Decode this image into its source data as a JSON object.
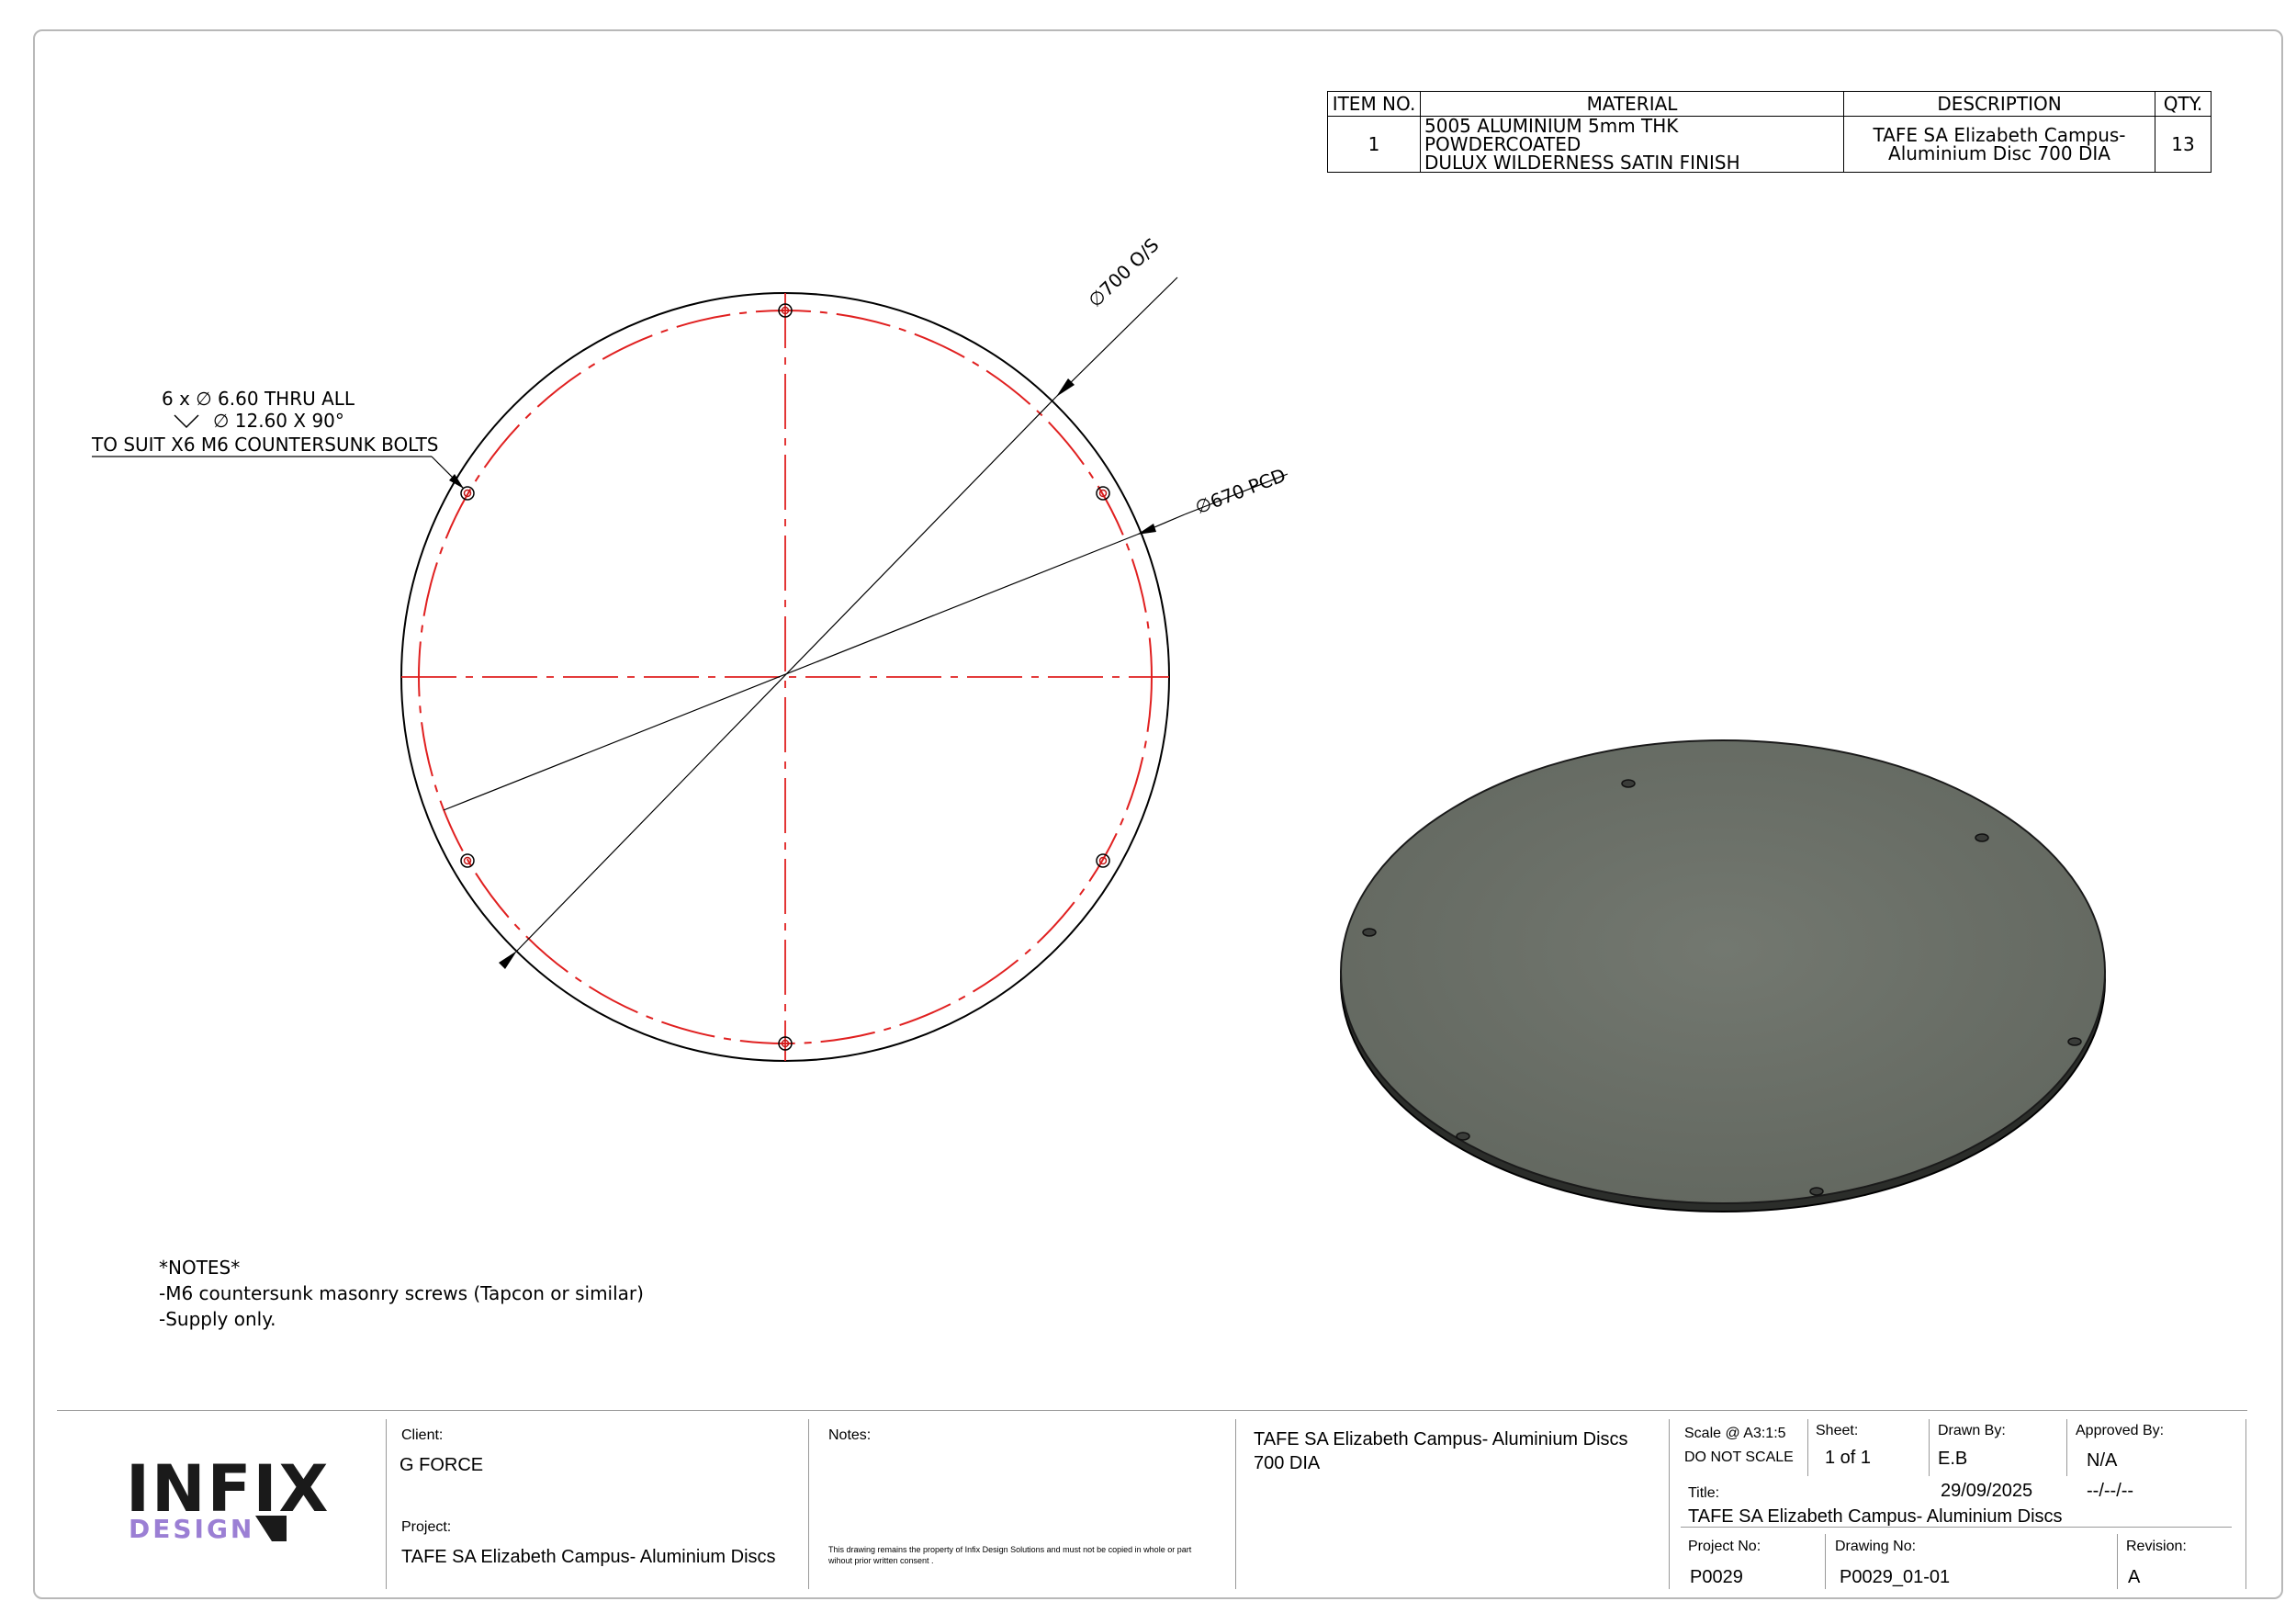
{
  "bom": {
    "headers": [
      "ITEM NO.",
      "MATERIAL",
      "DESCRIPTION",
      "QTY."
    ],
    "row": {
      "item_no": "1",
      "material_line1": "5005 ALUMINIUM 5mm THK POWDERCOATED",
      "material_line2": "DULUX WILDERNESS SATIN FINISH",
      "description_line1": "TAFE SA Elizabeth Campus-",
      "description_line2": "Aluminium Disc 700 DIA",
      "qty": "13"
    }
  },
  "drawing": {
    "callout_hole_line1": "6 x ∅ 6.60 THRU ALL",
    "callout_hole_line2": "∅ 12.60 X 90°",
    "callout_hole_line3": "TO SUIT X6 M6 COUNTERSUNK BOLTS",
    "dim_outside": "∅700 O/S",
    "dim_pcd": "∅670 PCD",
    "line_color": "#000000",
    "centerline_color": "#e02020",
    "plate_color": "#6b7068"
  },
  "notes": {
    "heading": "*NOTES*",
    "line1": "-M6 countersunk masonry screws (Tapcon or similar)",
    "line2": "-Supply only."
  },
  "title_block": {
    "logo_main": "INFIX",
    "logo_sub": "DESIGN",
    "client_label": "Client:",
    "client_value": "G FORCE",
    "project_label": "Project:",
    "project_value": "TAFE SA Elizabeth Campus- Aluminium Discs",
    "notes_label": "Notes:",
    "notes_disclaimer": "This drawing remains the property of Infix Design Solutions and must not be copied in whole or part wihout prior written consent .",
    "drawing_desc_line1": "TAFE SA Elizabeth Campus- Aluminium Discs",
    "drawing_desc_line2": "700 DIA",
    "scale_label": "Scale @ A3:1:5",
    "do_not_scale": "DO NOT SCALE",
    "sheet_label": "Sheet:",
    "sheet_value": "1  of  1",
    "drawn_by_label": "Drawn By:",
    "drawn_by_value": "E.B",
    "drawn_date": "29/09/2025",
    "approved_by_label": "Approved By:",
    "approved_by_value": "N/A",
    "approved_date": "--/--/--",
    "title_label": "Title:",
    "title_value": "TAFE SA Elizabeth Campus- Aluminium Discs",
    "project_no_label": "Project No:",
    "project_no_value": "P0029",
    "drawing_no_label": "Drawing No:",
    "drawing_no_value": "P0029_01-01",
    "revision_label": "Revision:",
    "revision_value": "A"
  }
}
